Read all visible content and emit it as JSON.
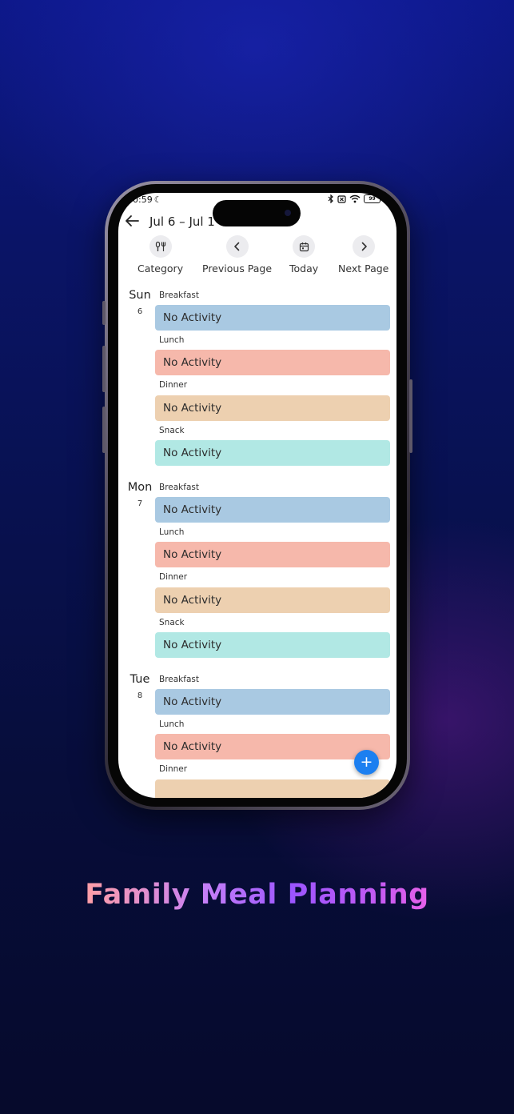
{
  "status_bar": {
    "time": "0:59",
    "battery": "99"
  },
  "header": {
    "range_title": "Jul 6 – Jul 1"
  },
  "toolbar": {
    "category_label": "Category",
    "previous_label": "Previous Page",
    "today_label": "Today",
    "next_label": "Next Page"
  },
  "meal_colors": {
    "breakfast": "#a9c9e2",
    "lunch": "#f6b8ab",
    "dinner": "#edd0b0",
    "snack": "#b1e8e4"
  },
  "days": [
    {
      "name": "Sun",
      "date": "6",
      "meals": [
        {
          "label": "Breakfast",
          "activity": "No Activity"
        },
        {
          "label": "Lunch",
          "activity": "No Activity"
        },
        {
          "label": "Dinner",
          "activity": "No Activity"
        },
        {
          "label": "Snack",
          "activity": "No Activity"
        }
      ]
    },
    {
      "name": "Mon",
      "date": "7",
      "meals": [
        {
          "label": "Breakfast",
          "activity": "No Activity"
        },
        {
          "label": "Lunch",
          "activity": "No Activity"
        },
        {
          "label": "Dinner",
          "activity": "No Activity"
        },
        {
          "label": "Snack",
          "activity": "No Activity"
        }
      ]
    },
    {
      "name": "Tue",
      "date": "8",
      "meals": [
        {
          "label": "Breakfast",
          "activity": "No Activity"
        },
        {
          "label": "Lunch",
          "activity": "No Activity"
        },
        {
          "label": "Dinner",
          "activity": ""
        }
      ]
    }
  ],
  "fab_label": "+",
  "caption": "Family Meal Planning"
}
